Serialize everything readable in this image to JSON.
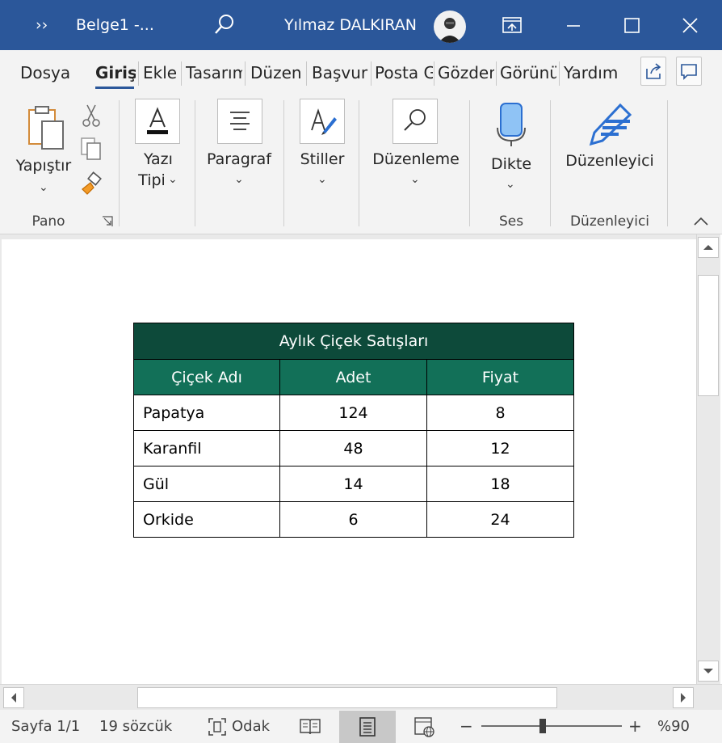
{
  "titlebar": {
    "quick_access": "››",
    "doc_title": "Belge1  -...",
    "user_name": "Yılmaz DALKIRAN"
  },
  "tabs": [
    {
      "label": "Dosya"
    },
    {
      "label": "Giriş",
      "active": true
    },
    {
      "label": "Ekle"
    },
    {
      "label": "Tasarım"
    },
    {
      "label": "Düzen"
    },
    {
      "label": "Başvurular"
    },
    {
      "label": "Posta Gönderileri"
    },
    {
      "label": "Gözden Geçir"
    },
    {
      "label": "Görünüm"
    },
    {
      "label": "Yardım"
    }
  ],
  "ribbon": {
    "pano": {
      "paste_label": "Yapıştır",
      "group_label": "Pano"
    },
    "font": {
      "label_line1": "Yazı",
      "label_line2": "Tipi"
    },
    "paragraph": {
      "label": "Paragraf"
    },
    "styles": {
      "label": "Stiller"
    },
    "editing": {
      "label": "Düzenleme"
    },
    "dictate": {
      "label": "Dikte",
      "group_label": "Ses"
    },
    "editor": {
      "label": "Düzenleyici",
      "group_label": "Düzenleyici"
    }
  },
  "table": {
    "title": "Aylık Çiçek Satışları",
    "headers": [
      "Çiçek Adı",
      "Adet",
      "Fiyat"
    ],
    "rows": [
      [
        "Papatya",
        "124",
        "8"
      ],
      [
        "Karanfil",
        "48",
        "12"
      ],
      [
        "Gül",
        "14",
        "18"
      ],
      [
        "Orkide",
        "6",
        "24"
      ]
    ]
  },
  "status": {
    "page": "Sayfa 1/1",
    "words": "19 sözcük",
    "focus": "Odak",
    "zoom_minus": "−",
    "zoom_plus": "+",
    "zoom": "%90"
  },
  "colors": {
    "titlebar": "#2b579a",
    "table_caption_bg": "#0d4a3a",
    "table_header_bg": "#127058",
    "editor_icon": "#2b6fd1"
  }
}
